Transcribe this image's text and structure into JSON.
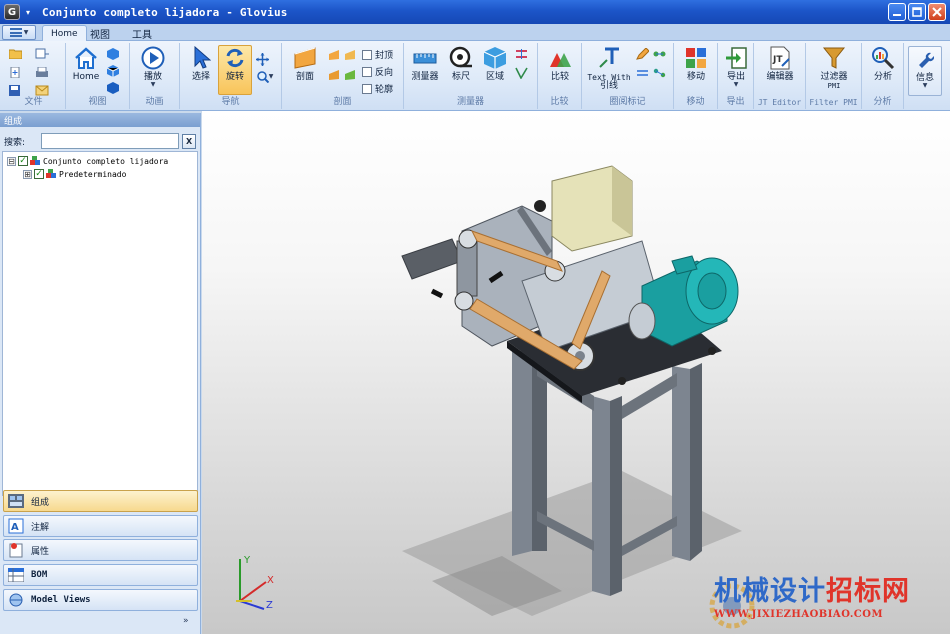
{
  "window": {
    "app_icon_letter": "G",
    "title": "Conjunto completo lijadora - Glovius"
  },
  "tabs": [
    {
      "label": "Home",
      "active": true
    },
    {
      "label": "视图",
      "active": false
    },
    {
      "label": "工具",
      "active": false
    }
  ],
  "ribbon": {
    "groups": {
      "file": "文件",
      "view": "视图",
      "animation": "动画",
      "navigation": "导航",
      "section": "剖面",
      "measure": "测量器",
      "compare": "比较",
      "markup": "圈阅标记",
      "move": "移动",
      "export": "导出",
      "jt_editor": "JT Editor",
      "filter_pmi": "Filter PMI",
      "analysis": "分析"
    },
    "buttons": {
      "home": "Home",
      "play": "播放",
      "select": "选择",
      "rotate": "旋转",
      "section": "剖面",
      "cap": "封顶",
      "reverse": "反向",
      "outline": "轮廓",
      "measure": "测量器",
      "ruler": "标尺",
      "area": "区域",
      "compare": "比较",
      "text_with_line_1": "Text With",
      "text_with_line_2": "引线",
      "move": "移动",
      "export": "导出",
      "editor": "编辑器",
      "filter": "过滤器",
      "filter_sub": "PMI",
      "analyze": "分析",
      "info": "信息"
    }
  },
  "left_panel": {
    "header": "组成",
    "search_label": "搜索:",
    "search_value": "",
    "clear_label": "X",
    "tree": [
      {
        "label": "Conjunto completo lijadora",
        "expander": "⊟",
        "checked": true
      },
      {
        "label": "Predeterminado",
        "expander": "⊞",
        "checked": true
      }
    ],
    "nav": [
      {
        "label": "组成",
        "active": true
      },
      {
        "label": "注解",
        "active": false
      },
      {
        "label": "属性",
        "active": false
      },
      {
        "label": "BOM",
        "active": false
      },
      {
        "label": "Model Views",
        "active": false
      }
    ],
    "more": "»"
  },
  "viewport": {
    "axes": {
      "x": "X",
      "y": "Y",
      "z": "Z"
    },
    "watermark_cn_blue": "机械设计",
    "watermark_cn_red": "招标网",
    "watermark_url": "WWW.JIXIEZHAOBIAO.COM"
  }
}
